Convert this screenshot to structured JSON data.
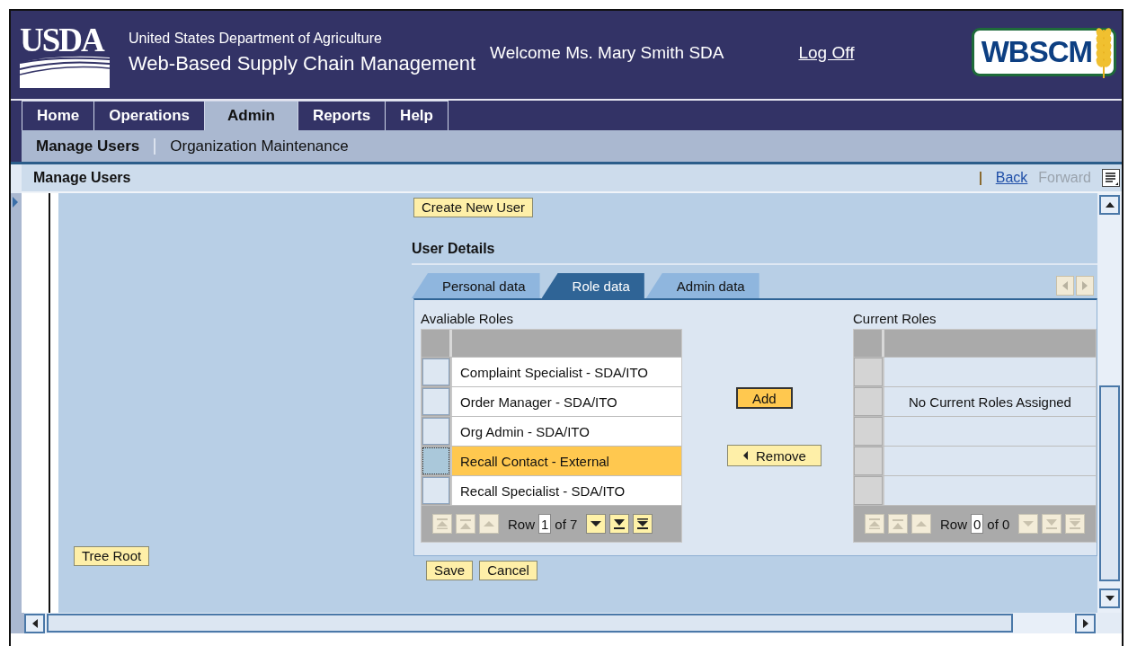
{
  "header": {
    "agency_logo": "USDA",
    "agency": "United States Department of Agriculture",
    "app_title": "Web-Based Supply Chain Management",
    "welcome": "Welcome Ms. Mary Smith SDA",
    "logoff": "Log Off",
    "app_logo": "WBSCM"
  },
  "nav_tabs": [
    {
      "label": "Home",
      "selected": false
    },
    {
      "label": "Operations",
      "selected": false
    },
    {
      "label": "Admin",
      "selected": true
    },
    {
      "label": "Reports",
      "selected": false
    },
    {
      "label": "Help",
      "selected": false
    }
  ],
  "sub_nav": [
    {
      "label": "Manage Users",
      "selected": true
    },
    {
      "label": "Organization Maintenance",
      "selected": false
    }
  ],
  "page_title": "Manage Users",
  "page_links": [
    {
      "label": "Back",
      "disabled": false
    },
    {
      "label": "Forward",
      "disabled": true
    }
  ],
  "tree_pane": {
    "button": "Tree Root"
  },
  "detail": {
    "create_button": "Create New User",
    "section_title": "User Details",
    "tabs": [
      {
        "label": "Personal data",
        "selected": false
      },
      {
        "label": "Role data",
        "selected": true
      },
      {
        "label": "Admin data",
        "selected": false
      }
    ],
    "available_roles": {
      "title": "Avaliable Roles",
      "rows": [
        {
          "label": "Complaint Specialist - SDA/ITO",
          "selected": false
        },
        {
          "label": "Order Manager - SDA/ITO",
          "selected": false
        },
        {
          "label": "Org Admin - SDA/ITO",
          "selected": false
        },
        {
          "label": "Recall Contact - External",
          "selected": true
        },
        {
          "label": "Recall Specialist - SDA/ITO",
          "selected": false
        }
      ],
      "pager": {
        "label": "Row",
        "value": "1",
        "total": "of 7",
        "buttons": [
          {
            "kind": "first",
            "disabled": true
          },
          {
            "kind": "page_up",
            "disabled": true
          },
          {
            "kind": "up",
            "disabled": true
          },
          {
            "kind": "down",
            "disabled": false
          },
          {
            "kind": "page_down",
            "disabled": false
          },
          {
            "kind": "last",
            "disabled": false
          }
        ]
      }
    },
    "transfer_buttons": [
      {
        "kind": "add",
        "label": "Add",
        "emphasized": true
      },
      {
        "kind": "remove",
        "label": "Remove",
        "emphasized": false
      }
    ],
    "current_roles": {
      "title": "Current Roles",
      "empty_message": "No Current Roles Assigned",
      "pager": {
        "label": "Row",
        "value": "0",
        "total": "of 0",
        "buttons": [
          {
            "kind": "first",
            "disabled": true
          },
          {
            "kind": "page_up",
            "disabled": true
          },
          {
            "kind": "up",
            "disabled": true
          },
          {
            "kind": "down",
            "disabled": true
          },
          {
            "kind": "page_down",
            "disabled": true
          },
          {
            "kind": "last",
            "disabled": true
          }
        ]
      }
    },
    "actions": [
      "Save",
      "Cancel"
    ]
  }
}
